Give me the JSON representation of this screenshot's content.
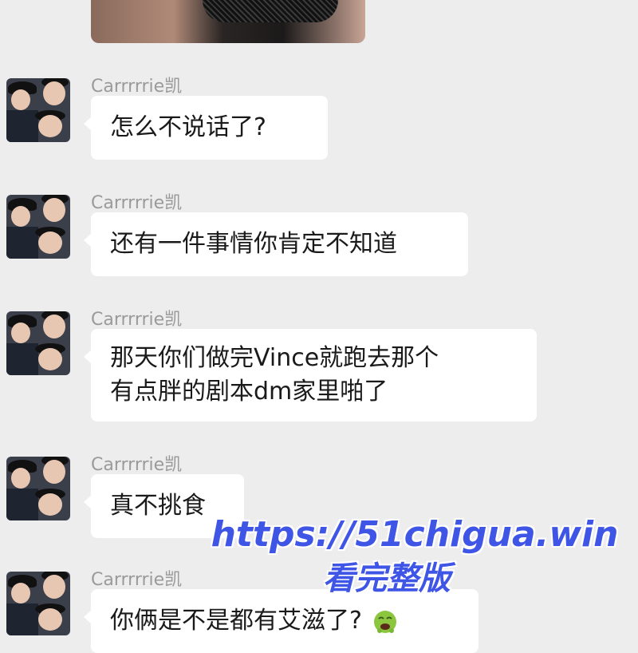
{
  "sender_name": "Carrrrrie凯",
  "messages": [
    {
      "lines": [
        "怎么不说话了?"
      ]
    },
    {
      "lines": [
        "还有一件事情你肯定不知道"
      ]
    },
    {
      "lines": [
        "那天你们做完Vince就跑去那个",
        "有点胖的剧本dm家里啪了"
      ]
    },
    {
      "lines": [
        "真不挑食"
      ]
    },
    {
      "lines": [
        "你俩是不是都有艾滋了?"
      ],
      "emoji": "nauseated-face-icon"
    }
  ],
  "watermark": {
    "url": "https://51chigua.win",
    "subtitle": "看完整版"
  },
  "colors": {
    "background": "#ededed",
    "bubble": "#ffffff",
    "sender_text": "#9a9a9a",
    "watermark": "#3f55e6"
  }
}
